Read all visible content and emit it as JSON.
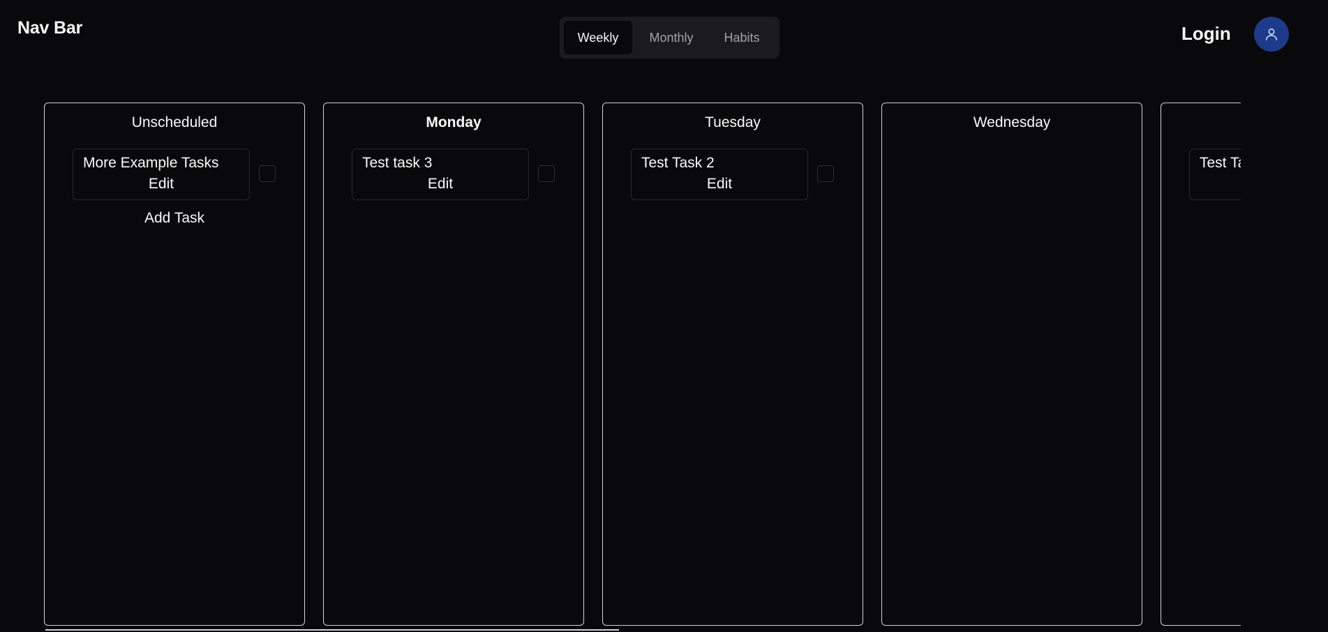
{
  "nav": {
    "brand": "Nav Bar",
    "tabs": [
      {
        "label": "Weekly",
        "active": true
      },
      {
        "label": "Monthly",
        "active": false
      },
      {
        "label": "Habits",
        "active": false
      }
    ],
    "login_label": "Login",
    "avatar_icon": "user-icon",
    "avatar_color": "#1e3a8a"
  },
  "board": {
    "columns": [
      {
        "title": "Unscheduled",
        "tasks": [
          {
            "name": "More Example Tasks",
            "edit_label": "Edit"
          }
        ],
        "add_task_label": "Add Task"
      },
      {
        "title": "Monday",
        "tasks": [
          {
            "name": "Test task 3",
            "edit_label": "Edit"
          }
        ]
      },
      {
        "title": "Tuesday",
        "tasks": [
          {
            "name": "Test Task 2",
            "edit_label": "Edit"
          }
        ]
      },
      {
        "title": "Wednesday",
        "tasks": []
      },
      {
        "title": "",
        "tasks": [
          {
            "name": "Test Ta",
            "edit_label": ""
          }
        ]
      }
    ]
  },
  "colors": {
    "background": "#09090b",
    "border": "#d4d4d8",
    "accent": "#1e3a8a"
  }
}
